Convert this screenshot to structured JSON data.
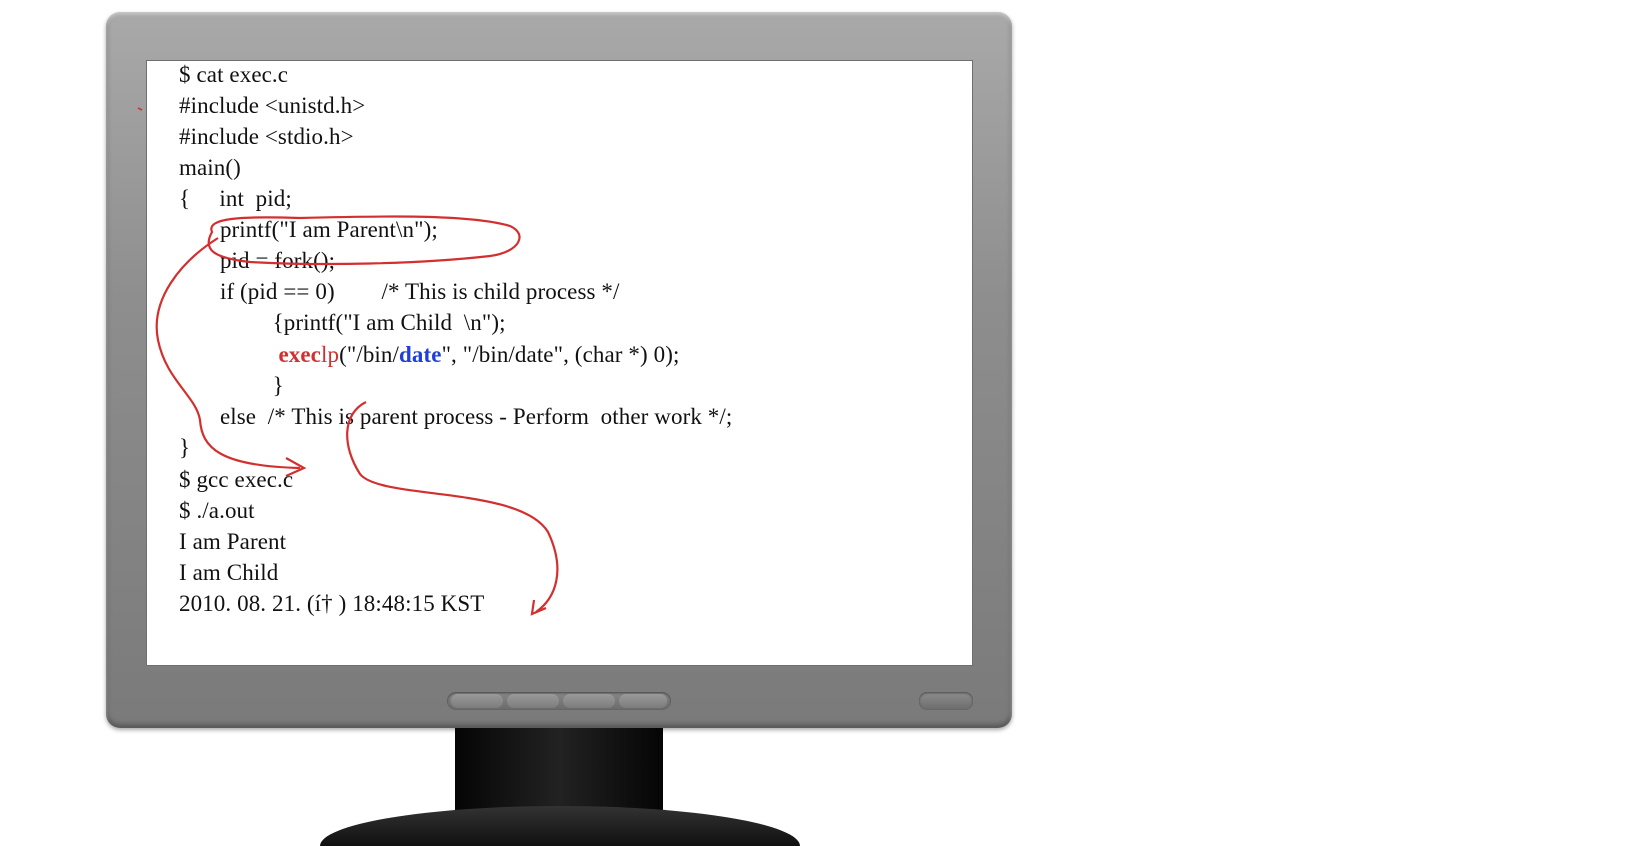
{
  "terminal": {
    "lines": [
      "$ cat exec.c",
      "#include <unistd.h>",
      "#include <stdio.h>",
      "main()",
      "{     int  pid;",
      "       printf(\"I am Parent\\n\");",
      "       pid = fork();",
      "       if (pid == 0)        /* This is child process */",
      "                {printf(\"I am Child  \\n\");",
      "       else  /* This is parent process - Perform  other work */;",
      "}",
      "$ gcc exec.c",
      "$ ./a.out",
      "I am Parent",
      "I am Child",
      "2010. 08. 21. (í† ) 18:48:15 KST"
    ],
    "exec_line": {
      "indent": "                 ",
      "fn_bold": "exec",
      "fn_rest": "lp",
      "arg_prefix": "(\"/bin/",
      "arg_highlight": "date",
      "arg_suffix": "\", \"/bin/date\", (char *) 0);"
    },
    "close_brace_line": "                }"
  },
  "colors": {
    "annotation": "#d32f2f",
    "highlight_blue": "#1f3fd6"
  }
}
